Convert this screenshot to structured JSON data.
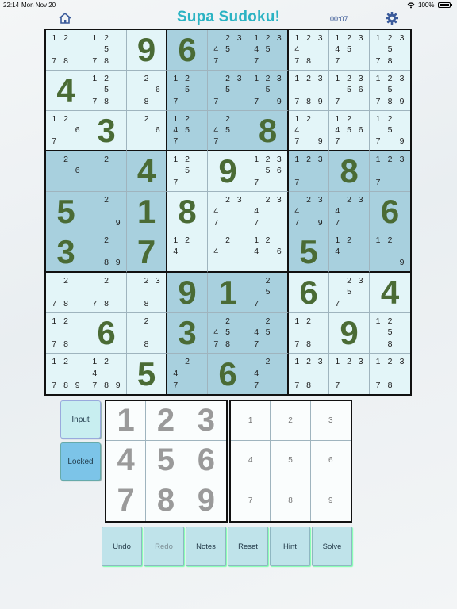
{
  "status_bar": {
    "time": "22:14",
    "date": "Mon Nov 20",
    "battery": "100%"
  },
  "header": {
    "home_icon": "house-icon",
    "title": "Supa Sudoku!",
    "timer": "00:07",
    "settings_icon": "gear-icon",
    "accent_color": "#2bb3c3"
  },
  "board": {
    "rows": [
      [
        {
          "n": "1 2   7 8"
        },
        {
          "n": "1 2  5 7 8"
        },
        {
          "v": "9"
        },
        {
          "v": "6"
        },
        {
          "n": "2 3 4 5 7 "
        },
        {
          "n": "1 2 3 4 5 7 "
        },
        {
          "n": "1 2 3 4 7 8"
        },
        {
          "n": "1 2 3 4 5 7 "
        },
        {
          "n": "1 2 3  5 7 8"
        }
      ],
      [
        {
          "v": "4"
        },
        {
          "n": "1 2  5 7 8"
        },
        {
          "n": " 2   6  8"
        },
        {
          "n": "1 2  5 7 "
        },
        {
          "n": " 2 3  5 7 "
        },
        {
          "n": "1 2 3  5 7  9"
        },
        {
          "n": "1 2 3   7 8 9"
        },
        {
          "n": "1 2 3  5 6 7 "
        },
        {
          "n": "1 2 3  5 7 8 9"
        }
      ],
      [
        {
          "n": "1 2   6 7"
        },
        {
          "v": "3"
        },
        {
          "n": " 2   6"
        },
        {
          "n": "1 2 4 5 7 "
        },
        {
          "n": " 2 4 5 7 "
        },
        {
          "v": "8"
        },
        {
          "n": "1 2 4 7  9"
        },
        {
          "n": "1 2 4 5 6 7 "
        },
        {
          "n": "1 2  5 7  9"
        }
      ],
      [
        {
          "n": " 2   6"
        },
        {
          "n": " 2"
        },
        {
          "v": "4"
        },
        {
          "n": "1 2  5 7 "
        },
        {
          "v": "9"
        },
        {
          "n": "1 2 3  5 6 7 "
        },
        {
          "n": "1 2 3 7"
        },
        {
          "v": "8"
        },
        {
          "n": "1 2 3 7"
        }
      ],
      [
        {
          "v": "5"
        },
        {
          "n": " 2      9"
        },
        {
          "v": "1"
        },
        {
          "v": "8"
        },
        {
          "n": " 2 3 4 7"
        },
        {
          "n": " 2 3 4 7"
        },
        {
          "n": " 2 3 4 7  9"
        },
        {
          "n": " 2 3 4 7"
        },
        {
          "v": "6"
        }
      ],
      [
        {
          "v": "3"
        },
        {
          "n": " 2     8 9"
        },
        {
          "v": "7"
        },
        {
          "n": "1 2 4"
        },
        {
          "n": " 2 4"
        },
        {
          "n": "1 2 4  6"
        },
        {
          "v": "5"
        },
        {
          "n": "1 2 4"
        },
        {
          "n": "1 2      9"
        }
      ],
      [
        {
          "n": " 2   7 8"
        },
        {
          "n": " 2   7 8"
        },
        {
          "n": " 2 3   8"
        },
        {
          "v": "9"
        },
        {
          "v": "1"
        },
        {
          "n": " 2  5 7 "
        },
        {
          "v": "6"
        },
        {
          "n": " 2 3  5 7"
        },
        {
          "v": "4"
        }
      ],
      [
        {
          "n": "1 2   7 8"
        },
        {
          "v": "6"
        },
        {
          "n": " 2    8"
        },
        {
          "v": "3"
        },
        {
          "n": " 2 4 5 7 8"
        },
        {
          "n": " 2 4 5 7 "
        },
        {
          "n": "1 2   7 8"
        },
        {
          "v": "9"
        },
        {
          "n": "1 2  5 8"
        }
      ],
      [
        {
          "n": "1 2   7 8 9"
        },
        {
          "n": "1 2 4 7 8 9"
        },
        {
          "v": "5"
        },
        {
          "n": " 2 4 7"
        },
        {
          "v": "6"
        },
        {
          "n": " 2 4 7"
        },
        {
          "n": "1 2 3   7 8"
        },
        {
          "n": "1 2 3   7"
        },
        {
          "n": "1 2 3   7 8"
        }
      ]
    ],
    "shading": [
      "LLLDDDLLL",
      "LLLDDDLLL",
      "LLLDDDLLL",
      "DDDLLLDDD",
      "DDDLLLDDD",
      "DDDLLLDDD",
      "LLLDDDLLL",
      "LLLDDDLLL",
      "LLLDDDLLL"
    ]
  },
  "mode_buttons": {
    "input": "Input",
    "locked": "Locked"
  },
  "numpad_big": [
    "1",
    "2",
    "3",
    "4",
    "5",
    "6",
    "7",
    "8",
    "9"
  ],
  "numpad_small": [
    "1",
    "2",
    "3",
    "4",
    "5",
    "6",
    "7",
    "8",
    "9"
  ],
  "actions": [
    {
      "label": "Undo",
      "enabled": true
    },
    {
      "label": "Redo",
      "enabled": false
    },
    {
      "label": "Notes",
      "enabled": true
    },
    {
      "label": "Reset",
      "enabled": true
    },
    {
      "label": "Hint",
      "enabled": true
    },
    {
      "label": "Solve",
      "enabled": true
    }
  ]
}
